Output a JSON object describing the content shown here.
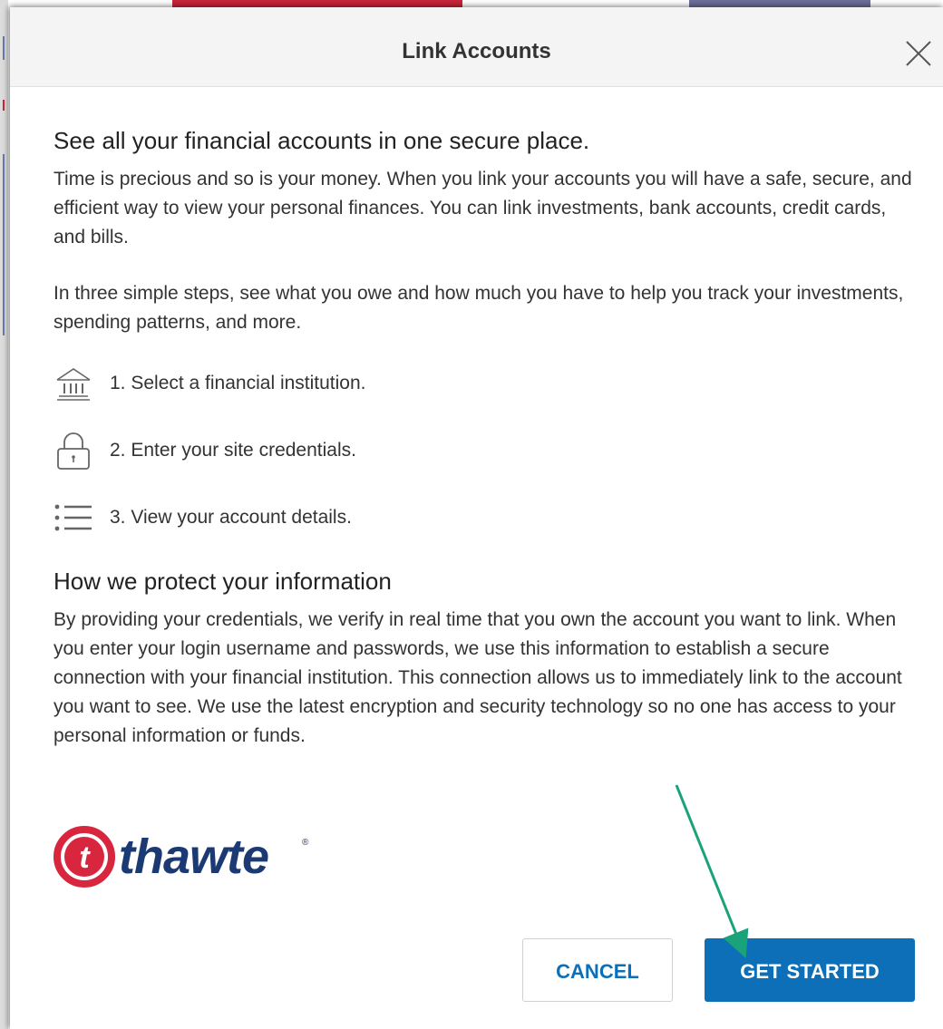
{
  "dialog": {
    "title": "Link Accounts",
    "close_label": "×"
  },
  "intro": {
    "heading": "See all your financial accounts in one secure place.",
    "paragraphs": [
      "Time is precious and so is your money. When you link your accounts you will have a safe, secure, and efficient way to view your personal finances. You can link investments, bank accounts, credit cards, and bills.",
      "In three simple steps, see what you owe and how much you have to help you track your investments, spending patterns, and more."
    ]
  },
  "steps": [
    {
      "icon": "bank-icon",
      "text": "1. Select a financial institution."
    },
    {
      "icon": "lock-icon",
      "text": "2. Enter your site credentials."
    },
    {
      "icon": "list-icon",
      "text": "3. View your account details."
    }
  ],
  "protection": {
    "heading": "How we protect your information",
    "paragraph": "By providing your credentials, we verify in real time that you own the account you want to link. When you enter your login username and passwords, we use this information to establish a secure connection with your financial institution. This connection allows us to immediately link to the account you want to see. We use the latest encryption and security technology so no one has access to your personal information or funds."
  },
  "logo": {
    "name": "thawte",
    "mark_letter": "t",
    "registered": "®",
    "colors": {
      "mark": "#d7263d",
      "word": "#1b3a73"
    }
  },
  "buttons": {
    "cancel_label": "CANCEL",
    "primary_label": "GET STARTED"
  },
  "colors": {
    "primary": "#0d6fb8",
    "annotation_arrow": "#1aa37a",
    "header_bg": "#f4f4f4"
  }
}
